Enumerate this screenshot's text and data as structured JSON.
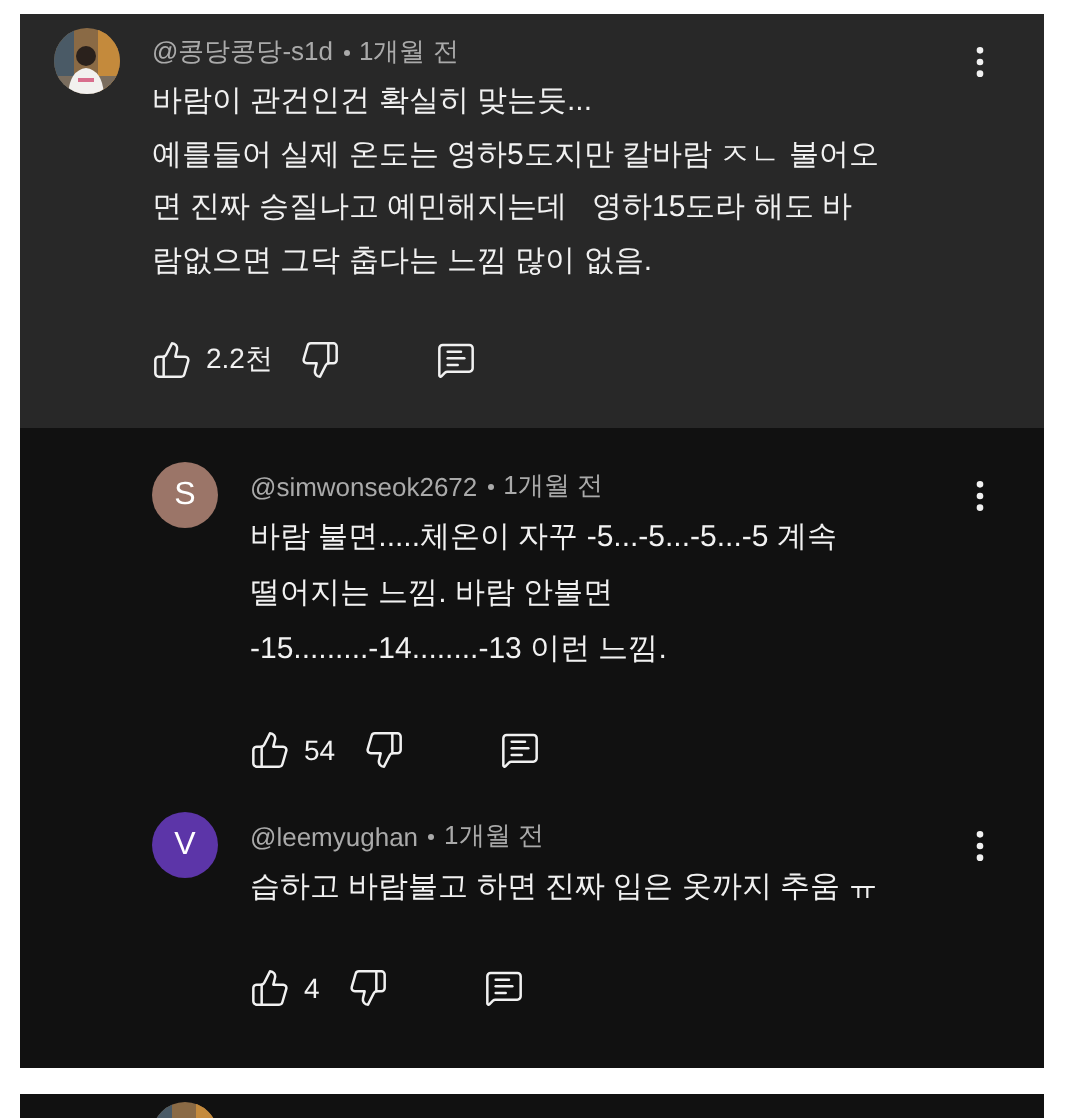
{
  "thread": {
    "author": "@콩당콩당-s1d",
    "time": "1개월 전",
    "lines": [
      "바람이 관건인건 확실히 맞는듯...",
      "예를들어 실제 온도는 영하5도지만 칼바람 ㅈㄴ 불어오",
      "면 진짜 승질나고 예민해지는데   영하15도라 해도 바",
      "람없으면 그닥 춥다는 느낌 많이 없음."
    ],
    "likes": "2.2천"
  },
  "replies": [
    {
      "author": "@simwonseok2672",
      "time": "1개월 전",
      "avatar": {
        "kind": "letter",
        "letter": "S",
        "color": "#9b7568"
      },
      "lines": [
        "바람 불면.....체온이 자꾸 -5...-5...-5...-5 계속",
        "떨어지는 느낌. 바람 안불면",
        "-15.........-14........-13 이런 느낌."
      ],
      "likes": "54"
    },
    {
      "author": "@leemyughan",
      "time": "1개월 전",
      "avatar": {
        "kind": "letter",
        "letter": "V",
        "color": "#5c35a8"
      },
      "lines": [
        "습하고 바람불고 하면 진짜 입은 옷까지 추움 ㅠ"
      ],
      "likes": "4"
    }
  ]
}
